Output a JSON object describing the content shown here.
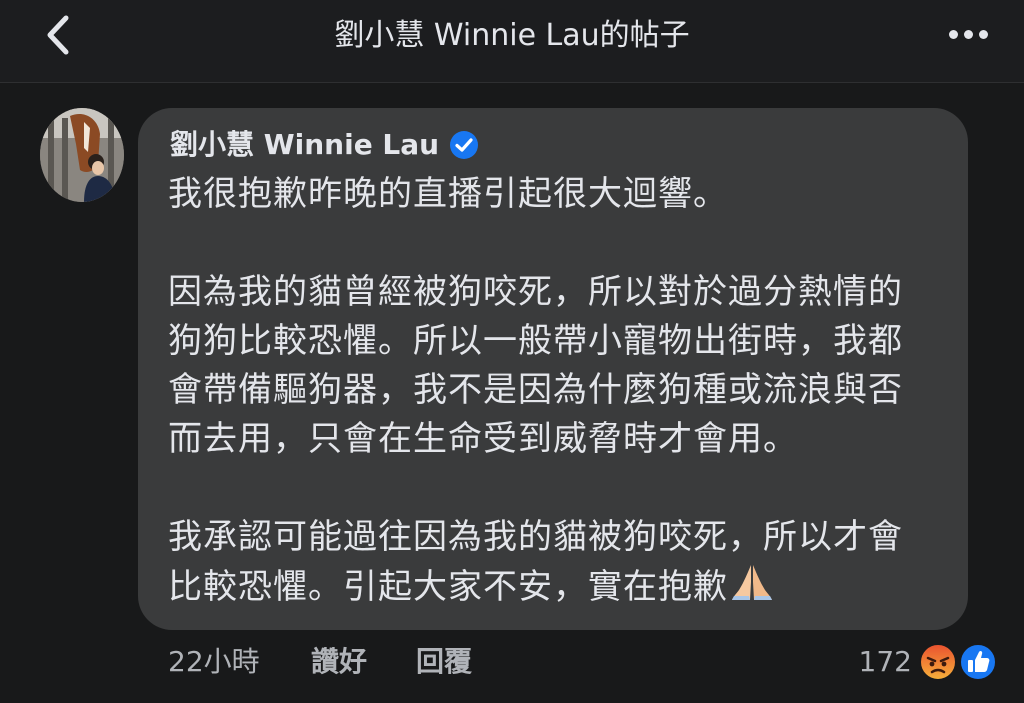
{
  "header": {
    "title": "劉小慧 Winnie Lau的帖子",
    "back_icon": "chevron-left-icon",
    "more_icon": "more-horizontal-icon"
  },
  "comment": {
    "author": "劉小慧 Winnie Lau",
    "verified": true,
    "lines": [
      "我很抱歉昨晚的直播引起很大迴響。",
      "",
      "因為我的貓曾經被狗咬死，所以對於過分熱情的",
      "狗狗比較恐懼。所以一般帶小寵物出街時，我都",
      "會帶備驅狗器，我不是因為什麼狗種或流浪與否",
      "而去用，只會在生命受到威脅時才會用。",
      "",
      "我承認可能過往因為我的貓被狗咬死，所以才會",
      "比較恐懼。引起大家不安，實在抱歉"
    ],
    "trailing_emoji": "folded-hands-icon"
  },
  "actions": {
    "timestamp": "22小時",
    "like_label": "讚好",
    "reply_label": "回覆"
  },
  "reactions": {
    "count": "172",
    "icons": [
      "angry-reaction-icon",
      "like-reaction-icon"
    ]
  },
  "colors": {
    "background": "#18191a",
    "bubble": "#3a3b3c",
    "text_primary": "#e4e6eb",
    "text_secondary": "#b0b3b8",
    "verified_blue": "#1877f2"
  }
}
